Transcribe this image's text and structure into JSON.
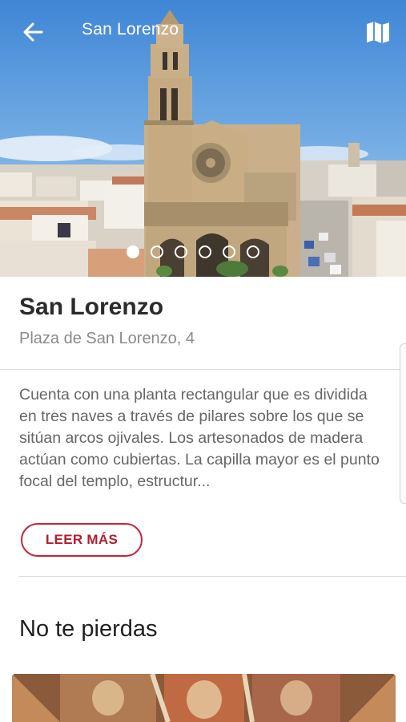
{
  "header": {
    "title": "San Lorenzo",
    "back_icon": "arrow-left-icon",
    "map_icon": "map-icon"
  },
  "gallery": {
    "total_images": 6,
    "active_index": 0
  },
  "place": {
    "name": "San Lorenzo",
    "address": "Plaza de San Lorenzo, 4",
    "description": "Cuenta con una planta rectangular que es dividida en tres naves a través de pilares sobre los que se sitúan arcos ojivales. Los artesonados de madera actúan como cubiertas. La capilla mayor es el punto focal del templo, estructur...",
    "read_more_label": "LEER MÁS"
  },
  "section": {
    "title": "No te pierdas"
  },
  "colors": {
    "accent": "#c2263a",
    "title_text": "#2b2b2b",
    "secondary_text": "#8a8a8a"
  }
}
